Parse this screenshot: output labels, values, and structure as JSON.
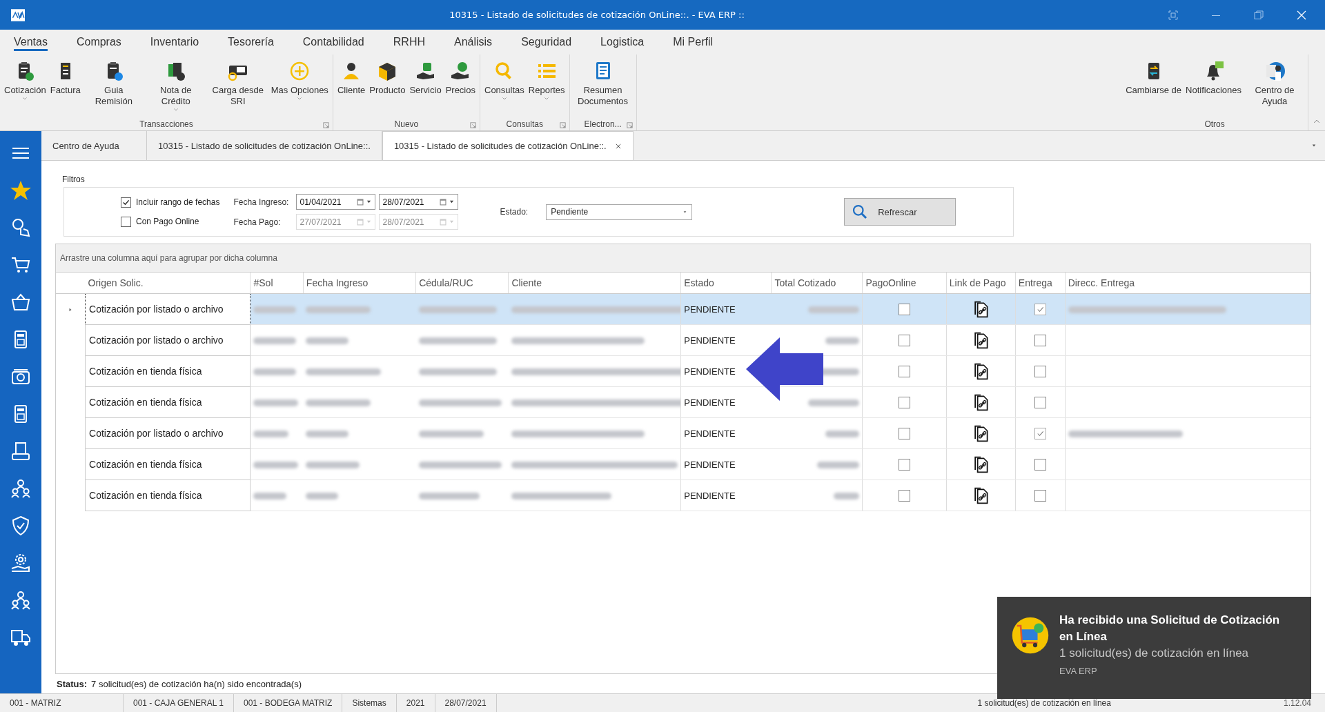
{
  "window": {
    "title": "10315 - Listado de solicitudes de cotización OnLine::. - EVA ERP ::"
  },
  "menu": [
    {
      "label": "Ventas",
      "selected": true
    },
    {
      "label": "Compras",
      "selected": false
    },
    {
      "label": "Inventario",
      "selected": false
    },
    {
      "label": "Tesorería",
      "selected": false
    },
    {
      "label": "Contabilidad",
      "selected": false
    },
    {
      "label": "RRHH",
      "selected": false
    },
    {
      "label": "Análisis",
      "selected": false
    },
    {
      "label": "Seguridad",
      "selected": false
    },
    {
      "label": "Logistica",
      "selected": false
    },
    {
      "label": "Mi Perfil",
      "selected": false
    }
  ],
  "ribbon_groups": [
    {
      "title": "Transacciones",
      "launcher": true,
      "buttons": [
        {
          "label": "Cotización",
          "dropdown": true
        },
        {
          "label": "Factura",
          "dropdown": false
        },
        {
          "label": "Guia Remisión",
          "dropdown": false
        },
        {
          "label": "Nota de Crédito",
          "dropdown": true
        },
        {
          "label": "Carga desde SRI",
          "dropdown": false
        },
        {
          "label": "Mas Opciones",
          "dropdown": true
        }
      ]
    },
    {
      "title": "Nuevo",
      "launcher": true,
      "buttons": [
        {
          "label": "Cliente",
          "dropdown": false
        },
        {
          "label": "Producto",
          "dropdown": false
        },
        {
          "label": "Servicio",
          "dropdown": false
        },
        {
          "label": "Precios",
          "dropdown": false
        }
      ]
    },
    {
      "title": "Consultas",
      "launcher": true,
      "buttons": [
        {
          "label": "Consultas",
          "dropdown": true
        },
        {
          "label": "Reportes",
          "dropdown": true
        }
      ]
    },
    {
      "title": "Electron...",
      "launcher": true,
      "buttons": [
        {
          "label": "Resumen Documentos",
          "dropdown": false
        }
      ]
    },
    {
      "title": "Otros",
      "launcher": false,
      "buttons": [
        {
          "label": "Cambiarse de",
          "dropdown": false
        },
        {
          "label": "Notificaciones",
          "dropdown": false
        },
        {
          "label": "Centro de Ayuda",
          "dropdown": false
        }
      ]
    }
  ],
  "doc_tabs": [
    {
      "label": "Centro de Ayuda",
      "selected": false,
      "closable": false
    },
    {
      "label": "10315 - Listado de solicitudes de cotización OnLine::.",
      "selected": false,
      "closable": false
    },
    {
      "label": "10315 - Listado de solicitudes de cotización OnLine::.",
      "selected": true,
      "closable": true
    }
  ],
  "filters": {
    "title": "Filtros",
    "include_range": {
      "label": "Incluir rango de fechas",
      "checked": true
    },
    "online_payment": {
      "label": "Con Pago Online",
      "checked": false
    },
    "fecha_ingreso": {
      "label": "Fecha Ingreso:",
      "from": "01/04/2021",
      "to": "28/07/2021",
      "disabled": false
    },
    "fecha_pago": {
      "label": "Fecha Pago:",
      "from": "27/07/2021",
      "to": "28/07/2021",
      "disabled": true
    },
    "estado": {
      "label": "Estado:",
      "value": "Pendiente"
    },
    "refresh_button": "Refrescar"
  },
  "grid": {
    "group_hint": "Arrastre una columna aquí para agrupar por dicha columna",
    "columns": [
      {
        "label": "Origen Solic.",
        "kind": "text"
      },
      {
        "label": "#Sol",
        "kind": "redacted"
      },
      {
        "label": "Fecha Ingreso",
        "kind": "redacted"
      },
      {
        "label": "Cédula/RUC",
        "kind": "redacted"
      },
      {
        "label": "Cliente",
        "kind": "redacted"
      },
      {
        "label": "Estado",
        "kind": "status"
      },
      {
        "label": "Total Cotizado",
        "kind": "redacted"
      },
      {
        "label": "PagoOnline",
        "kind": "pago"
      },
      {
        "label": "Link de Pago",
        "kind": "link"
      },
      {
        "label": "Entrega",
        "kind": "entrega"
      },
      {
        "label": "Direcc. Entrega",
        "kind": "address"
      }
    ],
    "rows": [
      {
        "origen": "Cotización por listado o archivo",
        "estado": "PENDIENTE",
        "pago_online": false,
        "entrega": true,
        "has_address": true,
        "selected": true
      },
      {
        "origen": "Cotización por listado o archivo",
        "estado": "PENDIENTE",
        "pago_online": false,
        "entrega": false,
        "has_address": false,
        "selected": false
      },
      {
        "origen": "Cotización en tienda física",
        "estado": "PENDIENTE",
        "pago_online": false,
        "entrega": false,
        "has_address": false,
        "selected": false
      },
      {
        "origen": "Cotización en tienda física",
        "estado": "PENDIENTE",
        "pago_online": false,
        "entrega": false,
        "has_address": false,
        "selected": false
      },
      {
        "origen": "Cotización por listado o archivo",
        "estado": "PENDIENTE",
        "pago_online": false,
        "entrega": true,
        "has_address": true,
        "selected": false
      },
      {
        "origen": "Cotización en tienda física",
        "estado": "PENDIENTE",
        "pago_online": false,
        "entrega": false,
        "has_address": false,
        "selected": false
      },
      {
        "origen": "Cotización en tienda física",
        "estado": "PENDIENTE",
        "pago_online": false,
        "entrega": false,
        "has_address": false,
        "selected": false
      }
    ]
  },
  "status": {
    "label": "Status:",
    "text": "7 solicitud(es) de cotización ha(n) sido encontrada(s)"
  },
  "status_bar": {
    "cells": [
      "001 - MATRIZ",
      "001 - CAJA GENERAL 1",
      "001 - BODEGA MATRIZ",
      "Sistemas",
      "2021",
      "28/07/2021"
    ],
    "message": "1 solicitud(es) de cotización en línea",
    "version": "1.12.04"
  },
  "notification": {
    "title": "Ha recibido una Solicitud de Cotización en Línea",
    "body": "1 solicitud(es) de cotización en línea",
    "source": "EVA ERP"
  }
}
